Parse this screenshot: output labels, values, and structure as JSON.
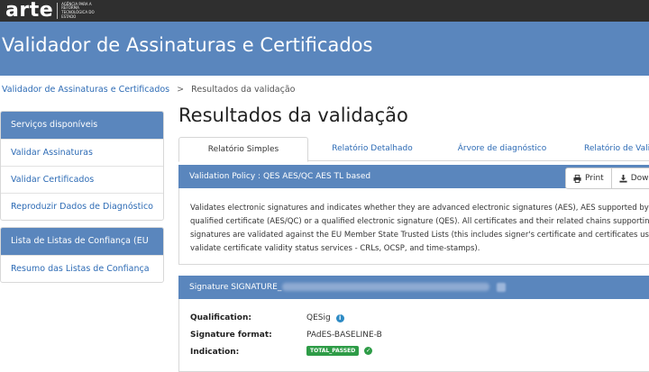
{
  "header": {
    "logo_text": "arte",
    "logo_subtitle": "Agência para a Reforma Tecnológica do Estado"
  },
  "banner": {
    "title": "Validador de Assinaturas e Certificados"
  },
  "breadcrumb": {
    "items": [
      "Validador de Assinaturas e Certificados",
      "Resultados da validação"
    ],
    "separator": ">"
  },
  "sidebar": {
    "panel1": {
      "title": "Serviços disponíveis",
      "items": [
        "Validar Assinaturas",
        "Validar Certificados",
        "Reproduzir Dados de Diagnóstico"
      ]
    },
    "panel2": {
      "title": "Lista de Listas de Confiança (EU LOTL)",
      "items": [
        "Resumo das Listas de Confiança"
      ]
    }
  },
  "main": {
    "title": "Resultados da validação",
    "tabs": [
      "Relatório Simples",
      "Relatório Detalhado",
      "Árvore de diagnóstico",
      "Relatório de Valida"
    ],
    "policy": {
      "title": "Validation Policy : QES AES/QC AES TL based",
      "print_label": "Print",
      "download_label": "Downl",
      "description": "Validates electronic signatures and indicates whether they are advanced electronic signatures (AES), AES supported by a qualified certificate (AES/QC) or a qualified electronic signature (QES). All certificates and their related chains supporting the signatures are validated against the EU Member State Trusted Lists (this includes signer's certificate and certificates used to validate certificate validity status services - CRLs, OCSP, and time-stamps)."
    },
    "signature": {
      "title_prefix": "Signature SIGNATURE_",
      "qualification_label": "Qualification:",
      "qualification_value": "QESig",
      "format_label": "Signature format:",
      "format_value": "PAdES-BASELINE-B",
      "indication_label": "Indication:",
      "indication_value": "TOTAL_PASSED"
    }
  },
  "colors": {
    "accent": "#5a86bd",
    "topbar": "#2f2f2f",
    "success": "#2e9c47",
    "link": "#2d6bb5"
  }
}
